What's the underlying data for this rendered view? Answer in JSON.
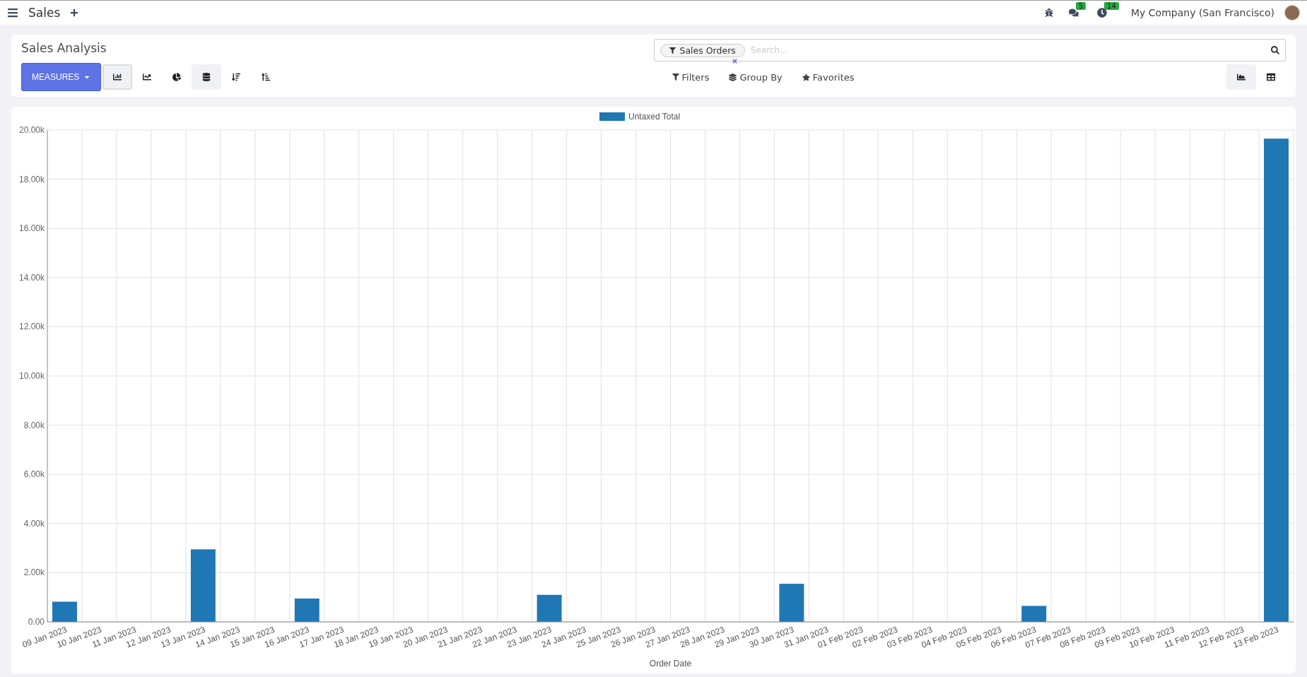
{
  "navbar": {
    "app_title": "Sales",
    "messages_badge": "5",
    "activities_badge": "14",
    "company": "My Company (San Francisco)"
  },
  "control_panel": {
    "title": "Sales Analysis",
    "measures_label": "MEASURES",
    "graph_modes": [
      {
        "kind": "bar",
        "selected": true
      },
      {
        "kind": "line",
        "selected": false
      },
      {
        "kind": "pie",
        "selected": false
      }
    ],
    "stacked": {
      "on": true
    },
    "search": {
      "facet": "Sales Orders",
      "placeholder": "Search..."
    },
    "filter_menus": [
      {
        "kind": "filters",
        "label": "Filters"
      },
      {
        "kind": "groupby",
        "label": "Group By"
      },
      {
        "kind": "favorites",
        "label": "Favorites"
      }
    ],
    "views": [
      {
        "kind": "graph",
        "selected": true
      },
      {
        "kind": "pivot",
        "selected": false
      }
    ]
  },
  "chart": {
    "chart_data": {
      "type": "bar",
      "grid": true,
      "xlabel": "Order Date",
      "categories": [
        "09 Jan 2023",
        "10 Jan 2023",
        "11 Jan 2023",
        "12 Jan 2023",
        "13 Jan 2023",
        "14 Jan 2023",
        "15 Jan 2023",
        "16 Jan 2023",
        "17 Jan 2023",
        "18 Jan 2023",
        "19 Jan 2023",
        "20 Jan 2023",
        "21 Jan 2023",
        "22 Jan 2023",
        "23 Jan 2023",
        "24 Jan 2023",
        "25 Jan 2023",
        "26 Jan 2023",
        "27 Jan 2023",
        "28 Jan 2023",
        "29 Jan 2023",
        "30 Jan 2023",
        "31 Jan 2023",
        "01 Feb 2023",
        "02 Feb 2023",
        "03 Feb 2023",
        "04 Feb 2023",
        "05 Feb 2023",
        "06 Feb 2023",
        "07 Feb 2023",
        "08 Feb 2023",
        "09 Feb 2023",
        "10 Feb 2023",
        "11 Feb 2023",
        "12 Feb 2023",
        "13 Feb 2023"
      ],
      "series": [
        {
          "name": "Untaxed Total",
          "color": "#1f77b4",
          "values": [
            820,
            0,
            0,
            0,
            2950,
            0,
            0,
            950,
            0,
            0,
            0,
            0,
            0,
            0,
            1100,
            0,
            0,
            0,
            0,
            0,
            0,
            1550,
            0,
            0,
            0,
            0,
            0,
            0,
            650,
            0,
            0,
            0,
            0,
            0,
            0,
            19650
          ]
        }
      ],
      "ylim": [
        0,
        20000
      ],
      "yticks": [
        {
          "value": 0,
          "label": "0.00"
        },
        {
          "value": 2000,
          "label": "2.00k"
        },
        {
          "value": 4000,
          "label": "4.00k"
        },
        {
          "value": 6000,
          "label": "6.00k"
        },
        {
          "value": 8000,
          "label": "8.00k"
        },
        {
          "value": 10000,
          "label": "10.00k"
        },
        {
          "value": 12000,
          "label": "12.00k"
        },
        {
          "value": 14000,
          "label": "14.00k"
        },
        {
          "value": 16000,
          "label": "16.00k"
        },
        {
          "value": 18000,
          "label": "18.00k"
        },
        {
          "value": 20000,
          "label": "20.00k"
        }
      ]
    }
  }
}
